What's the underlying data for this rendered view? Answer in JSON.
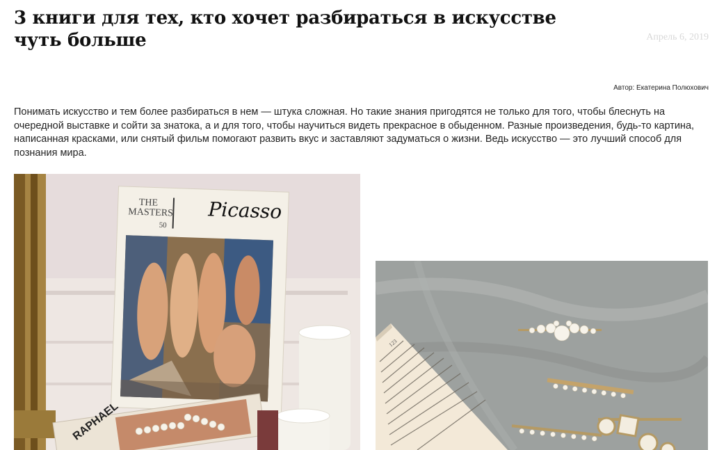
{
  "article": {
    "title": "3 книги для тех, кто хочет разбираться в искусстве чуть больше",
    "date": "Апрель 6, 2019",
    "author": "Автор: Екатерина Полюхович",
    "intro": "Понимать искусство и тем более разбираться в нем — штука сложная. Но такие знания пригодятся не только для того, чтобы блеснуть на очередной выставке и сойти за знатока, а и для того, чтобы научиться видеть прекрасное в обыденном. Разные произведения, будь-то картина, написанная красками, или снятый фильм помогают развить вкус и заставляют задуматься о жизни. Ведь искусство — это лучший способ для познания мира."
  },
  "images": {
    "left": {
      "book_series_line1": "THE",
      "book_series_line2": "MASTERS",
      "book_number": "50",
      "book_title": "Picasso",
      "spine_text": "RAPHAEL"
    },
    "right": {
      "page_number": "123"
    }
  },
  "colors": {
    "wall": "#e7dede",
    "wainscot": "#efe9e6",
    "book_cover": "#f3efe6",
    "linen": "#9a9e9c",
    "page": "#f1e7d6",
    "frame_gold": "#8a6a2e"
  }
}
